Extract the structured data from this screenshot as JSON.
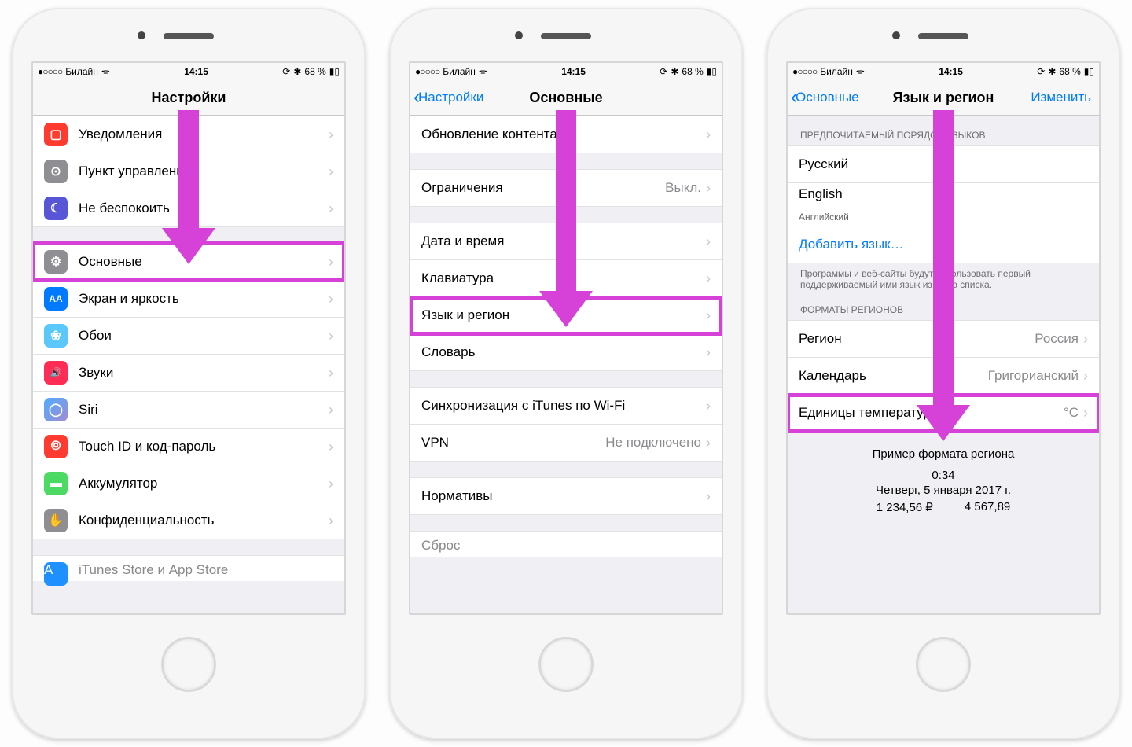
{
  "status": {
    "signal_dots": "●○○○○",
    "carrier": "Билайн",
    "wifi": "ᯤ",
    "time": "14:15",
    "rotation": "⟳",
    "bt": "✱",
    "battery_pct": "68 %",
    "battery_icon": "▮▯"
  },
  "screen1": {
    "title": "Настройки",
    "rows_g1": [
      {
        "icon_bg": "#ff3b30",
        "icon": "▢",
        "label": "Уведомления"
      },
      {
        "icon_bg": "#8e8e93",
        "icon": "⊙",
        "label": "Пункт управления"
      },
      {
        "icon_bg": "#5856d6",
        "icon": "☾",
        "label": "Не беспокоить"
      }
    ],
    "rows_g2": [
      {
        "icon_bg": "#8e8e93",
        "icon": "⚙",
        "label": "Основные",
        "hl": true
      },
      {
        "icon_bg": "#007aff",
        "icon": "AA",
        "label": "Экран и яркость"
      },
      {
        "icon_bg": "#5ac8fa",
        "icon": "❀",
        "label": "Обои"
      },
      {
        "icon_bg": "#ff2d55",
        "icon": "🔊",
        "label": "Звуки"
      },
      {
        "icon_bg": "linear-gradient(135deg,#4facfe,#a18cd1)",
        "icon": "◯",
        "label": "Siri"
      },
      {
        "icon_bg": "#ff3b30",
        "icon": "⦾",
        "label": "Touch ID и код-пароль"
      },
      {
        "icon_bg": "#4cd964",
        "icon": "▬",
        "label": "Аккумулятор"
      },
      {
        "icon_bg": "#8e8e93",
        "icon": "✋",
        "label": "Конфиденциальность"
      }
    ],
    "partial": {
      "icon_bg": "#1e90ff",
      "label": "iTunes Store и App Store"
    }
  },
  "screen2": {
    "back": "Настройки",
    "title": "Основные",
    "rows_g1": [
      {
        "label": "Обновление контента"
      }
    ],
    "rows_g2": [
      {
        "label": "Ограничения",
        "value": "Выкл."
      }
    ],
    "rows_g3": [
      {
        "label": "Дата и время"
      },
      {
        "label": "Клавиатура"
      },
      {
        "label": "Язык и регион",
        "hl": true
      },
      {
        "label": "Словарь"
      }
    ],
    "rows_g4": [
      {
        "label": "Синхронизация с iTunes по Wi-Fi"
      },
      {
        "label": "VPN",
        "value": "Не подключено"
      }
    ],
    "rows_g5": [
      {
        "label": "Нормативы"
      }
    ],
    "partial": {
      "label": "Сброс"
    }
  },
  "screen3": {
    "back": "Основные",
    "title": "Язык и регион",
    "edit": "Изменить",
    "header_langs": "ПРЕДПОЧИТАЕМЫЙ ПОРЯДОК ЯЗЫКОВ",
    "langs": [
      {
        "label": "Русский"
      },
      {
        "label": "English",
        "sub": "Английский"
      }
    ],
    "add_lang": "Добавить язык…",
    "footer_langs": "Программы и веб-сайты будут использовать первый поддерживаемый ими язык из этого списка.",
    "header_regions": "ФОРМАТЫ РЕГИОНОВ",
    "region_rows": [
      {
        "label": "Регион",
        "value": "Россия"
      },
      {
        "label": "Календарь",
        "value": "Григорианский"
      },
      {
        "label": "Единицы температуры",
        "value": "°C",
        "hl": true
      }
    ],
    "example": {
      "title": "Пример формата региона",
      "time": "0:34",
      "date": "Четверг, 5 января 2017 г.",
      "num1": "1 234,56 ₽",
      "num2": "4 567,89"
    }
  }
}
